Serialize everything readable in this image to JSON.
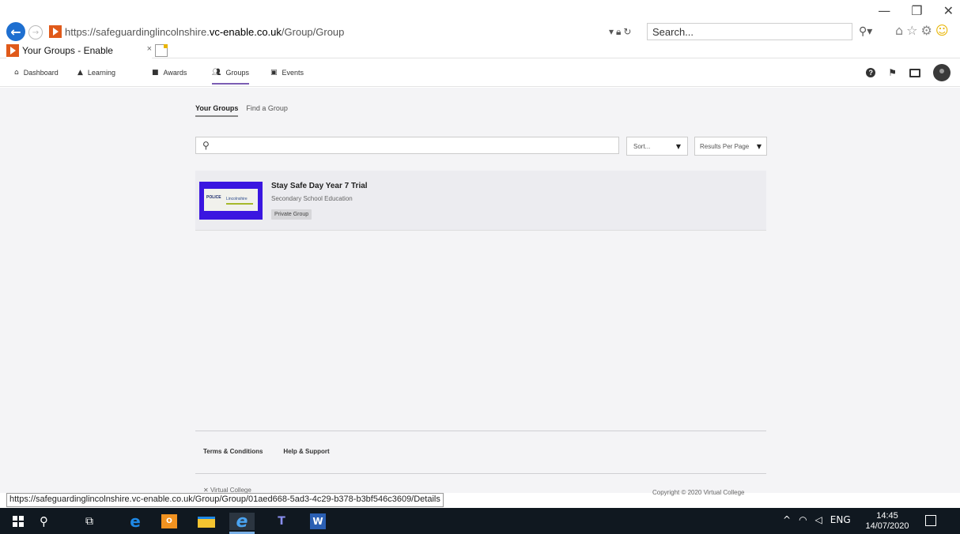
{
  "window": {
    "minimize": "—",
    "restore": "❐",
    "close": "✕"
  },
  "address_bar": {
    "url_prefix": "https://safeguardinglincolnshire.",
    "url_domain": "vc-enable.co.uk",
    "url_path": "/Group/Group",
    "search_placeholder": "Search..."
  },
  "browser_tab": {
    "title": "Your Groups - Enable",
    "close": "×"
  },
  "nav": {
    "items": [
      {
        "label": "Dashboard",
        "icon": "home-icon"
      },
      {
        "label": "Learning",
        "icon": "graduation-cap-icon"
      },
      {
        "label": "Awards",
        "icon": "award-icon"
      },
      {
        "label": "Groups",
        "icon": "users-icon",
        "active": true
      },
      {
        "label": "Events",
        "icon": "calendar-icon"
      }
    ]
  },
  "subtabs": [
    {
      "label": "Your Groups",
      "active": true
    },
    {
      "label": "Find a Group",
      "active": false
    }
  ],
  "filters": {
    "search_value": "",
    "sort_label": "Sort...",
    "results_per_page_label": "Results Per Page"
  },
  "groups": [
    {
      "title": "Stay Safe Day Year 7 Trial",
      "subtitle": "Secondary School Education",
      "badge": "Private Group",
      "thumb_text_left": "POLICE",
      "thumb_text_right": "Lincolnshire"
    }
  ],
  "footer": {
    "links": [
      "Terms & Conditions",
      "Help & Support"
    ],
    "brand": "Virtual College",
    "copyright": "Copyright © 2020 Virtual College"
  },
  "status_tooltip": "https://safeguardinglincolnshire.vc-enable.co.uk/Group/Group/01aed668-5ad3-4c29-b378-b3bf546c3609/Details",
  "taskbar": {
    "language": "ENG",
    "time": "14:45",
    "date": "14/07/2020"
  }
}
